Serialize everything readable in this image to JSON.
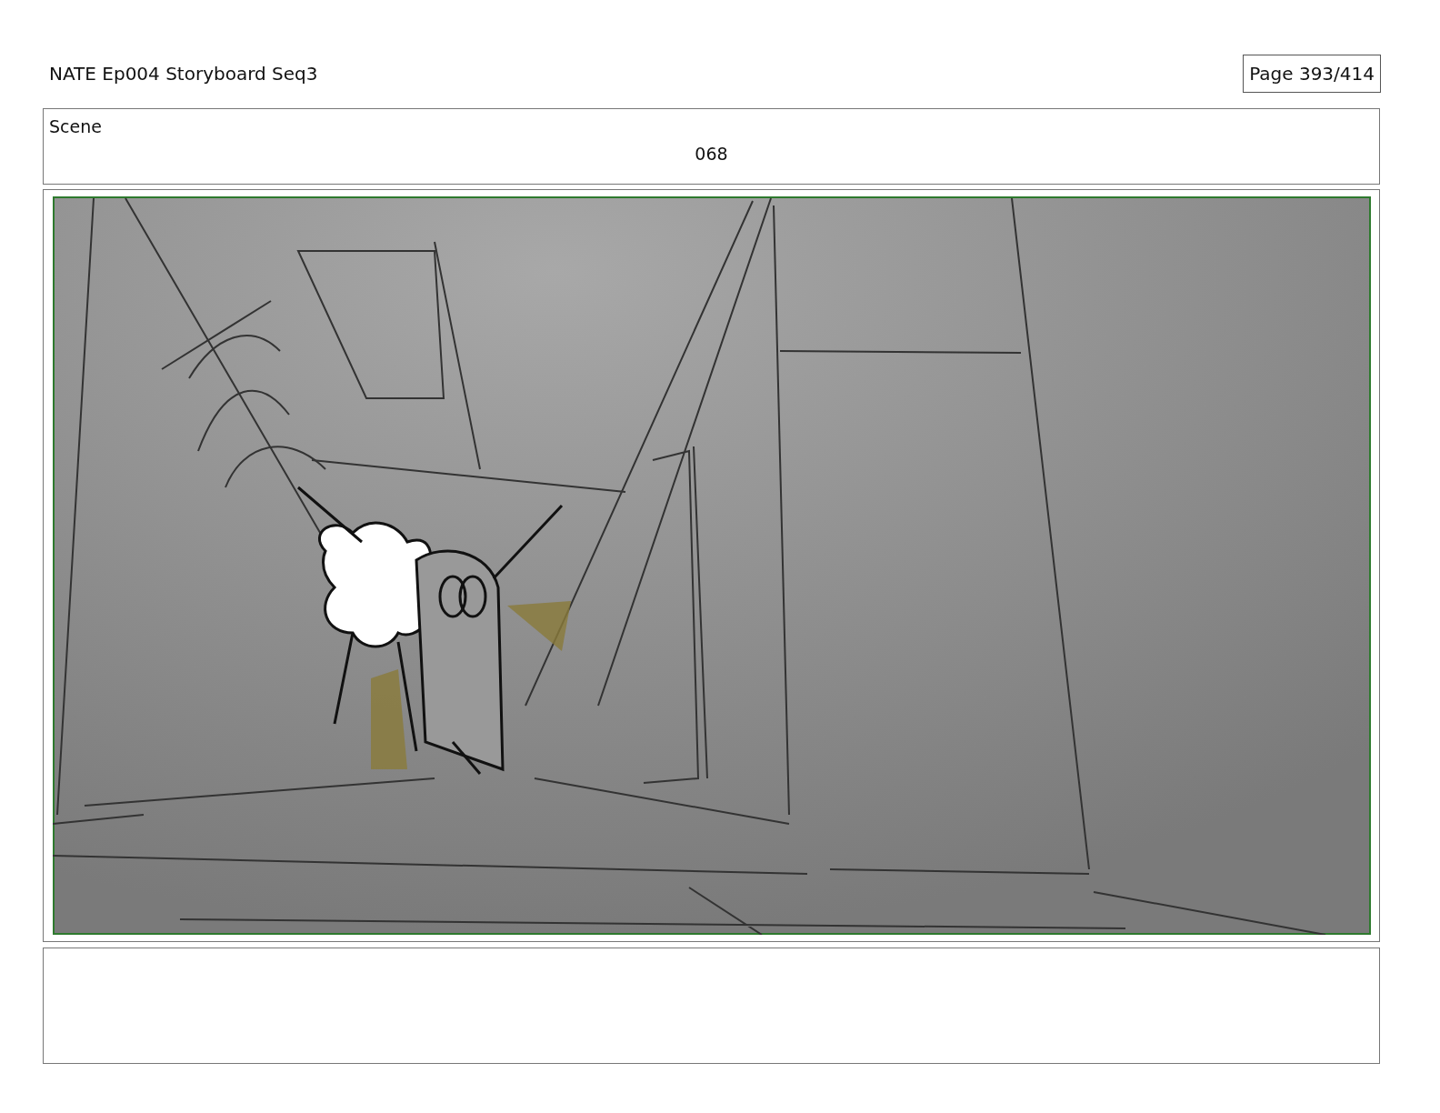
{
  "header": {
    "title": "NATE Ep004 Storyboard Seq3",
    "page": "Page 393/414"
  },
  "scene": {
    "label": "Scene",
    "number": "068"
  }
}
